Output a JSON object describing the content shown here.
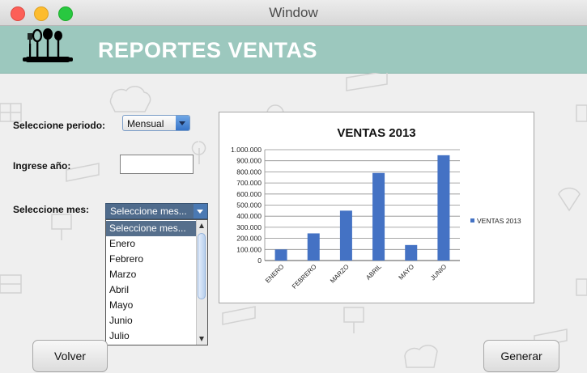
{
  "window": {
    "title": "Window"
  },
  "banner": {
    "title": "REPORTES VENTAS",
    "logo_icon": "kitchen-utensils-icon",
    "color": "#9cc8be"
  },
  "form": {
    "period_label": "Seleccione periodo:",
    "period_value": "Mensual",
    "year_label": "Ingrese año:",
    "year_value": "",
    "month_label": "Seleccione mes:",
    "month_value": "Seleccione mes...",
    "month_options": [
      "Seleccione mes...",
      "Enero",
      "Febrero",
      "Marzo",
      "Abril",
      "Mayo",
      "Junio",
      "Julio"
    ]
  },
  "chart_data": {
    "type": "bar",
    "title": "VENTAS 2013",
    "categories": [
      "ENERO",
      "FEBRERO",
      "MARZO",
      "ABRIL",
      "MAYO",
      "JUNIO"
    ],
    "series": [
      {
        "name": "VENTAS 2013",
        "values": [
          100000,
          245000,
          450000,
          790000,
          140000,
          950000
        ],
        "color": "#4472c4"
      }
    ],
    "ylim": [
      0,
      1000000
    ],
    "yticks": [
      0,
      100000,
      200000,
      300000,
      400000,
      500000,
      600000,
      700000,
      800000,
      900000,
      1000000
    ],
    "ytick_labels": [
      "0",
      "100.000",
      "200.000",
      "300.000",
      "400.000",
      "500.000",
      "600.000",
      "700.000",
      "800.000",
      "900.000",
      "1.000.000"
    ],
    "grid": true,
    "legend": "right"
  },
  "buttons": {
    "back": "Volver",
    "generate": "Generar"
  }
}
